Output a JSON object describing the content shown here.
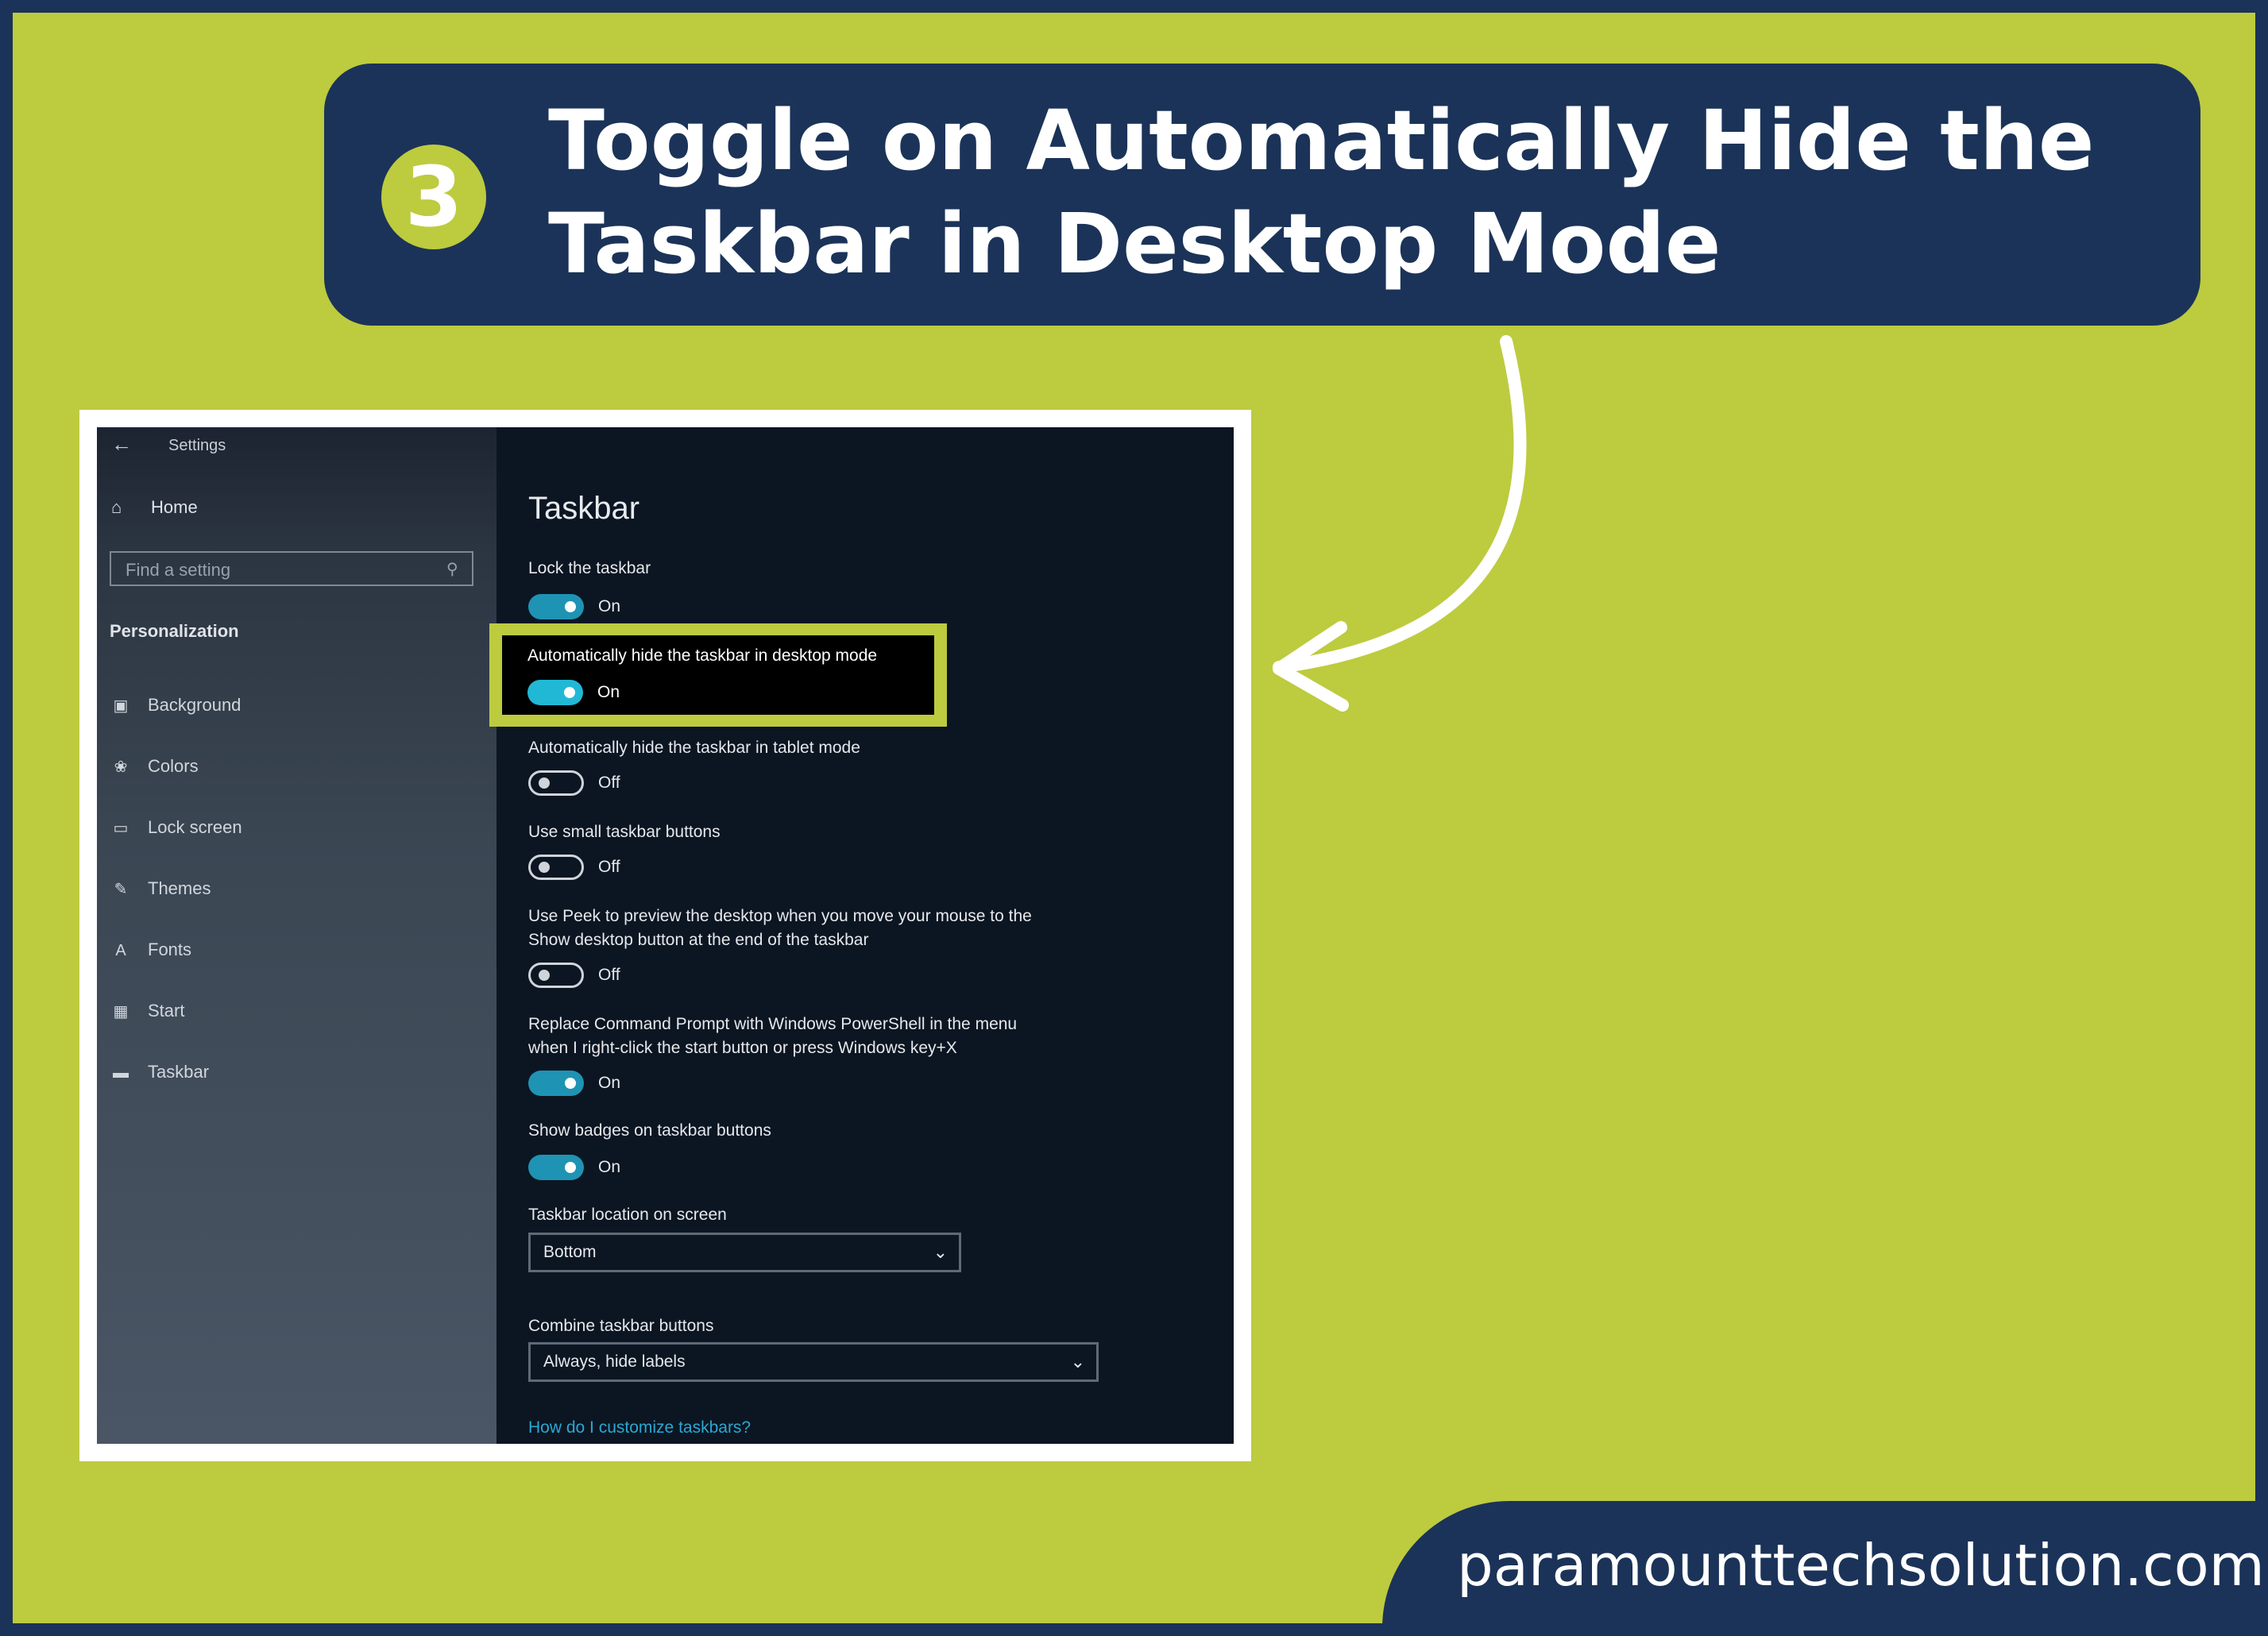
{
  "header": {
    "step_number": "3",
    "title": "Toggle on Automatically Hide the Taskbar in Desktop Mode"
  },
  "footer": {
    "site": "paramounttechsolution.com"
  },
  "colors": {
    "green": "#bdcb3f",
    "navy": "#1b3358",
    "accent": "#1f93b4"
  },
  "settings": {
    "window_title": "Settings",
    "back_icon": "back-arrow-icon",
    "home": {
      "label": "Home",
      "icon": "home-icon"
    },
    "search": {
      "placeholder": "Find a setting",
      "icon": "search-icon"
    },
    "section": "Personalization",
    "nav": [
      {
        "label": "Background",
        "icon": "picture-icon"
      },
      {
        "label": "Colors",
        "icon": "palette-icon"
      },
      {
        "label": "Lock screen",
        "icon": "lock-screen-icon"
      },
      {
        "label": "Themes",
        "icon": "brush-icon"
      },
      {
        "label": "Fonts",
        "icon": "fonts-icon"
      },
      {
        "label": "Start",
        "icon": "start-icon"
      },
      {
        "label": "Taskbar",
        "icon": "taskbar-icon"
      }
    ],
    "page_title": "Taskbar",
    "options": [
      {
        "label": "Lock the taskbar",
        "state": "On"
      },
      {
        "label": "Automatically hide the taskbar in desktop mode",
        "state": "On"
      },
      {
        "label": "Automatically hide the taskbar in tablet mode",
        "state": "Off"
      },
      {
        "label": "Use small taskbar buttons",
        "state": "Off"
      },
      {
        "label": "Use Peek to preview the desktop when you move your mouse to the",
        "label2": "Show desktop button at the end of the taskbar",
        "state": "Off"
      },
      {
        "label": "Replace Command Prompt with Windows PowerShell in the menu",
        "label2": "when I right-click the start button or press Windows key+X",
        "state": "On"
      },
      {
        "label": "Show badges on taskbar buttons",
        "state": "On"
      }
    ],
    "location": {
      "label": "Taskbar location on screen",
      "value": "Bottom"
    },
    "combine": {
      "label": "Combine taskbar buttons",
      "value": "Always, hide labels"
    },
    "help_link": "How do I customize taskbars?"
  }
}
